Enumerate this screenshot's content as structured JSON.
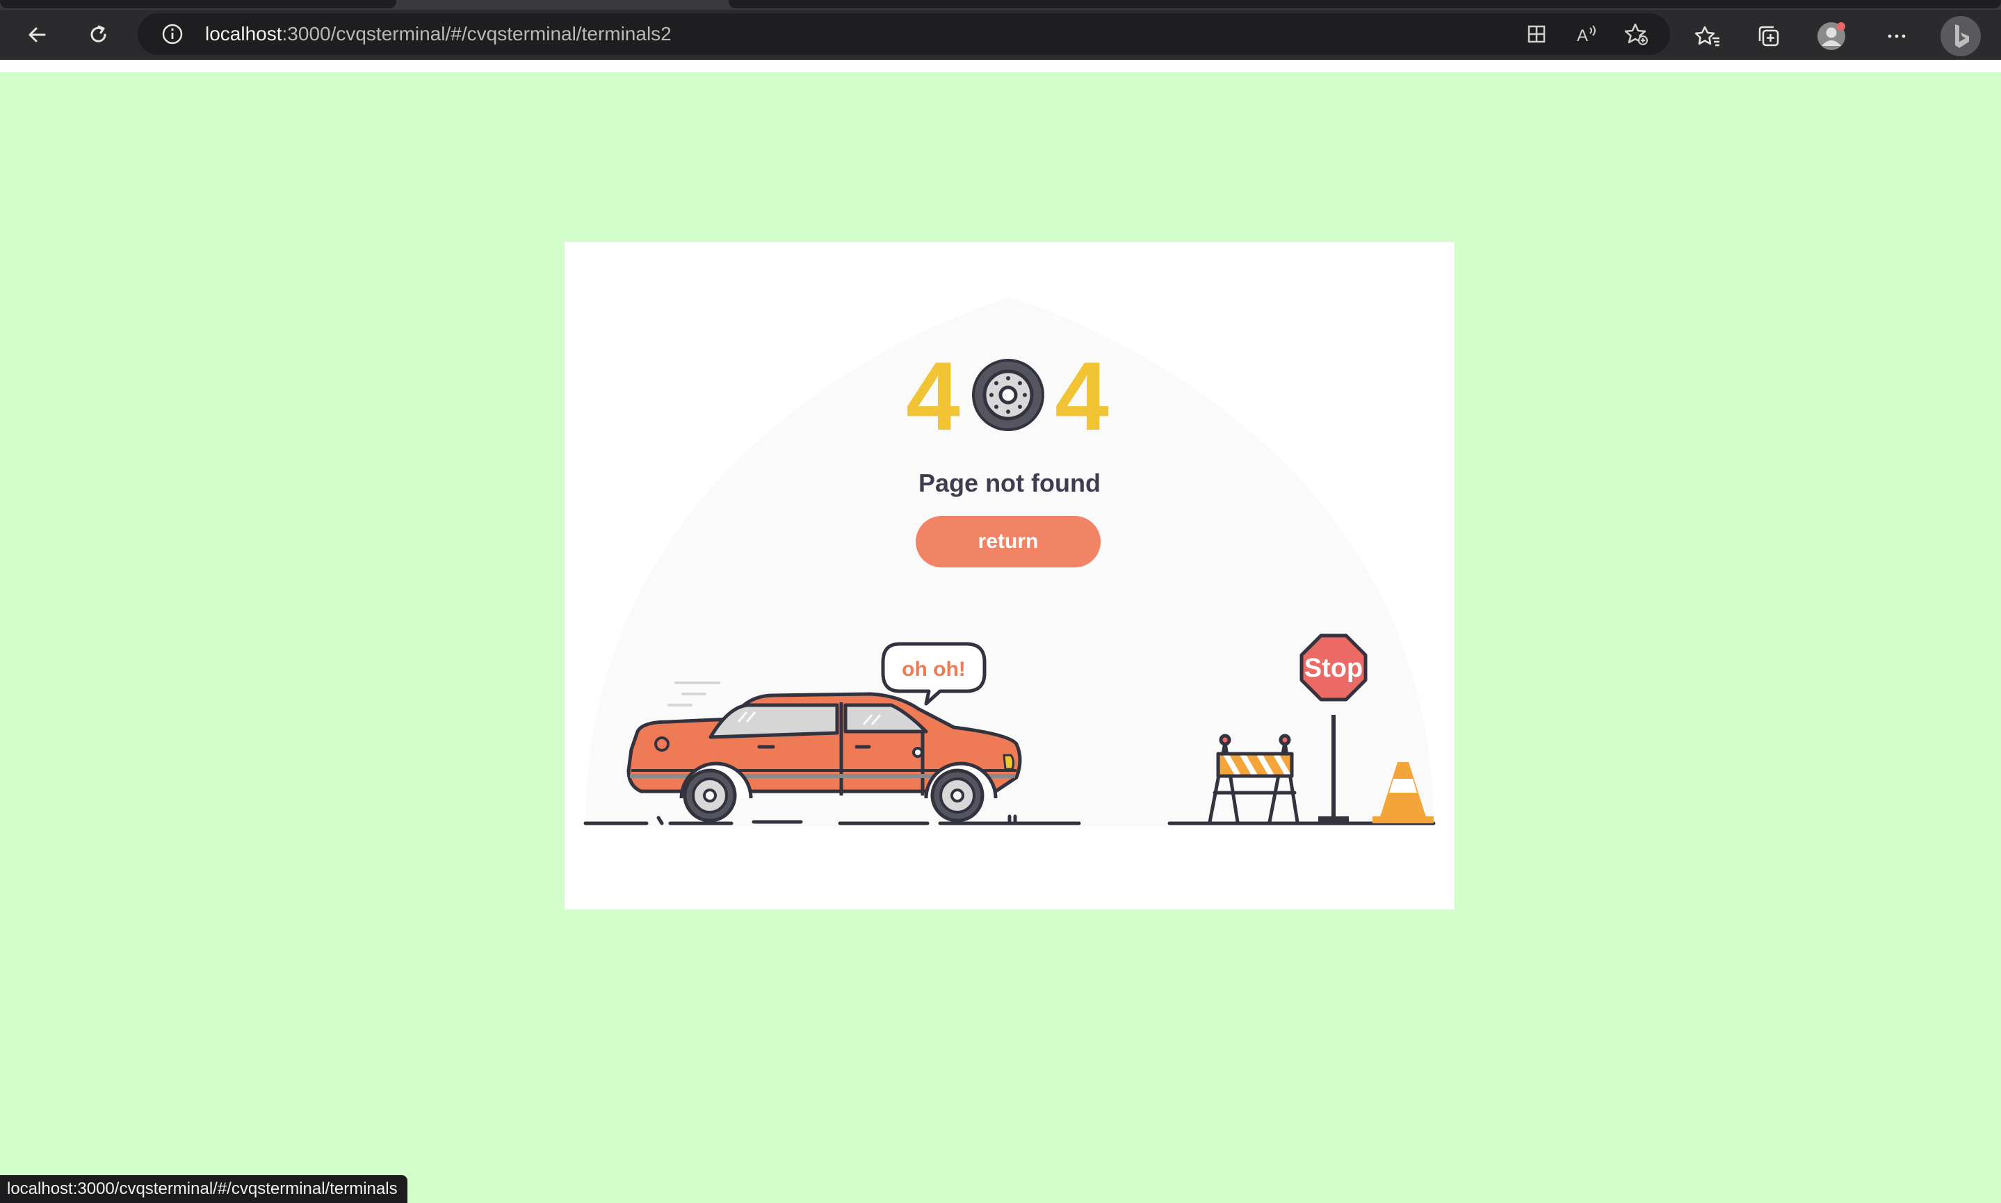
{
  "browser": {
    "url_host": "localhost",
    "url_path": ":3000/cvqsterminal/#/cvqsterminal/terminals2",
    "status_url": "localhost:3000/cvqsterminal/#/cvqsterminal/terminals",
    "toolbar_icons": [
      "back-arrow-icon",
      "refresh-icon",
      "info-icon",
      "app-available-icon",
      "read-aloud-icon",
      "add-favorite-icon",
      "favorites-icon",
      "collections-icon",
      "profile-avatar",
      "more-menu-icon",
      "bing-copilot-icon"
    ]
  },
  "page": {
    "background_color": "#d2fcca",
    "error_code_left": "4",
    "error_code_right": "4",
    "title": "Page not found",
    "return_label": "return",
    "speech_bubble": "oh oh!",
    "stop_sign": "Stop"
  },
  "colors": {
    "accent_yellow": "#f2c433",
    "button": "#f08464",
    "car_body": "#ee7b55",
    "stop_sign": "#ec6a66",
    "outline": "#333340"
  }
}
